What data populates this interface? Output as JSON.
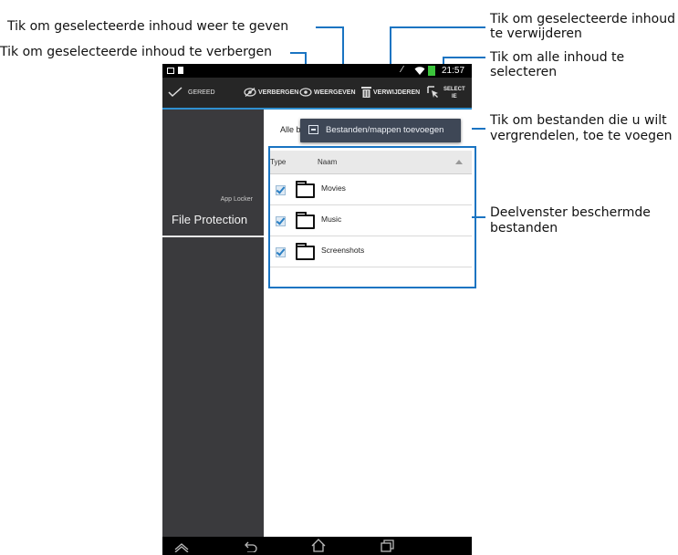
{
  "annotations": {
    "show": "Tik om geselecteerde inhoud weer te geven",
    "hide": "Tik om geselecteerde inhoud te verbergen",
    "delete_line1": "Tik om geselecteerde inhoud",
    "delete_line2": "te verwijderen",
    "select_all_line1": "Tik om alle inhoud te",
    "select_all_line2": "selecteren",
    "add_line1": "Tik om bestanden die u wilt",
    "add_line2": "vergrendelen, toe te voegen",
    "pane_line1": "Deelvenster beschermde",
    "pane_line2": "bestanden"
  },
  "status_bar": {
    "time": "21:57"
  },
  "action_bar": {
    "done": "GEREED",
    "hide": "VERBERGEN",
    "show": "WEERGEVEN",
    "delete": "VERWIJDEREN",
    "select_all_line1": "SELECT",
    "select_all_line2": "IE"
  },
  "sidebar": {
    "app_name": "App Locker",
    "section": "File Protection"
  },
  "content": {
    "filter_label": "Alle be",
    "add_button": "Bestanden/mappen toevoegen",
    "columns": {
      "type": "Type",
      "name": "Naam"
    },
    "rows": [
      {
        "name": "Movies",
        "checked": true
      },
      {
        "name": "Music",
        "checked": true
      },
      {
        "name": "Screenshots",
        "checked": true
      }
    ]
  },
  "colors": {
    "accent": "#2f8fd0",
    "highlight": "#1a74c2",
    "sidebar": "#3a3a3d",
    "actionbar": "#262626"
  },
  "icons": [
    "check-icon",
    "eye-slash-icon",
    "eye-icon",
    "trash-icon",
    "select-cursor-icon",
    "back-icon",
    "home-icon",
    "recent-apps-icon",
    "wifi-icon",
    "battery-icon"
  ]
}
